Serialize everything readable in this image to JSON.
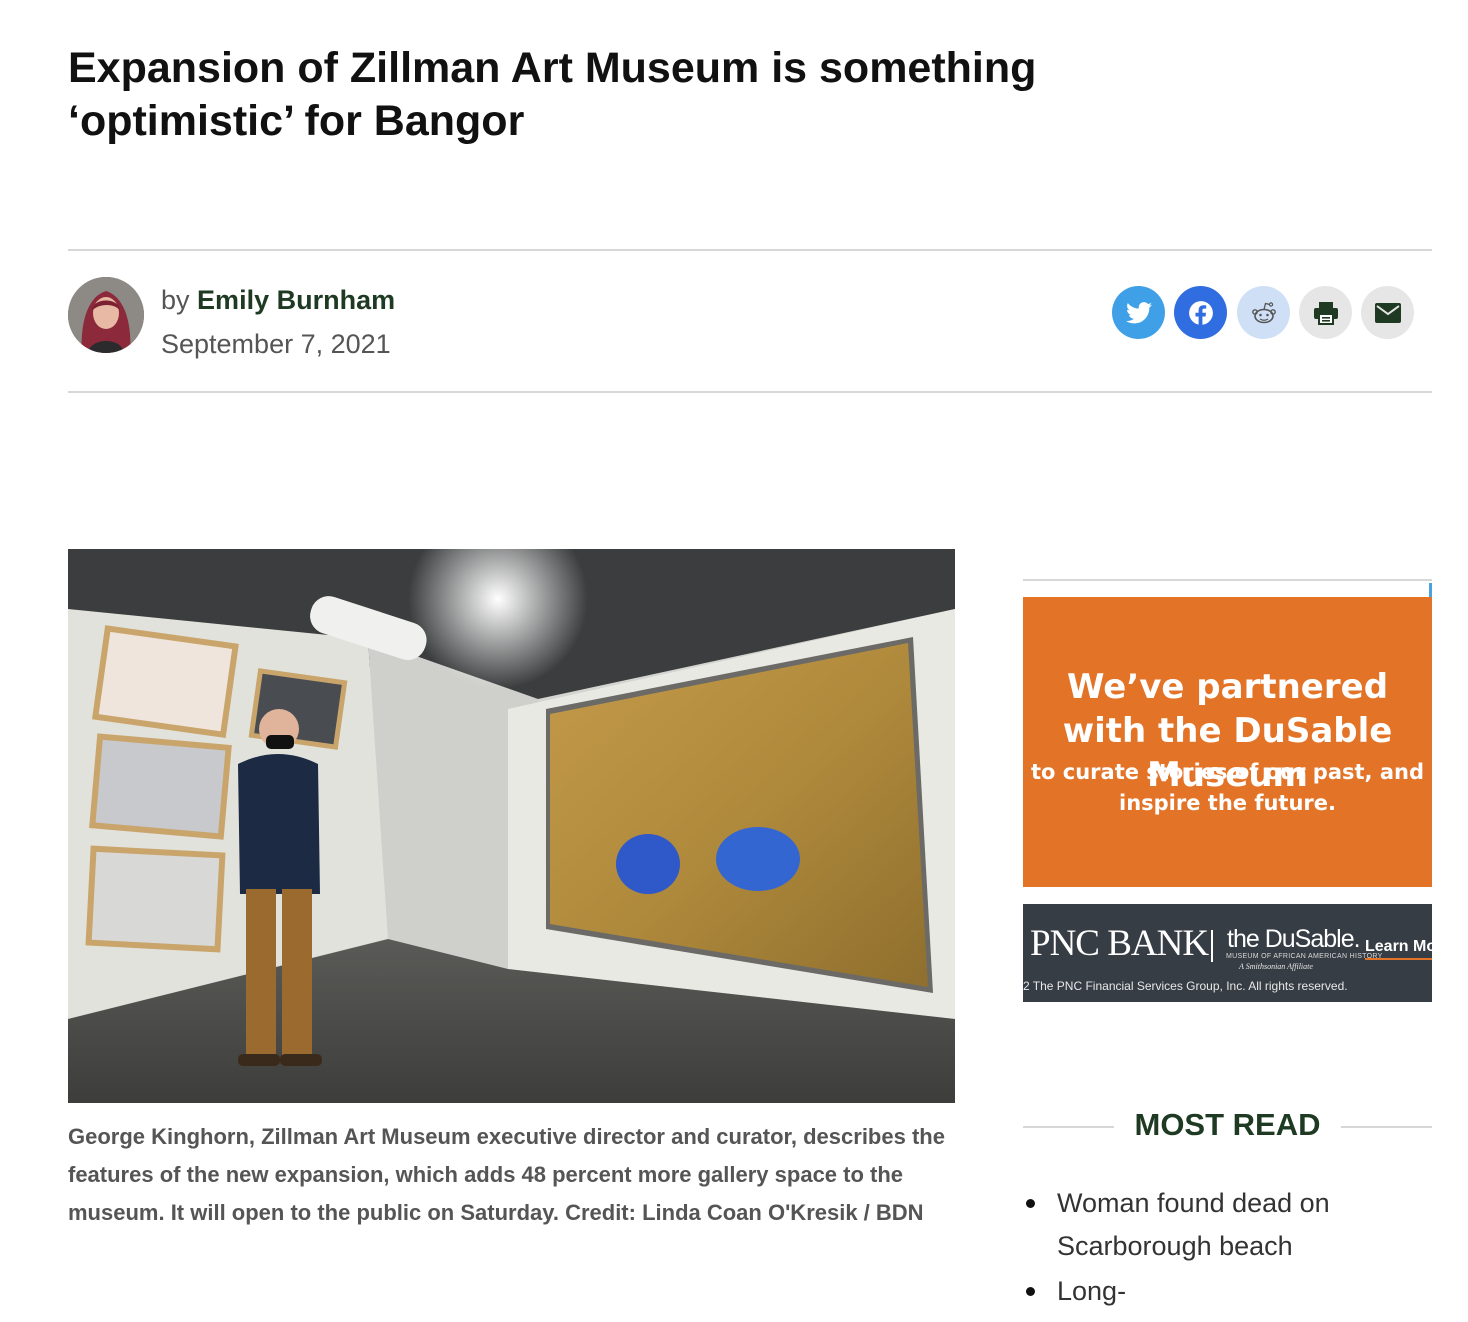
{
  "article": {
    "headline": "Expansion of Zillman Art Museum is something ‘optimistic’ for Bangor",
    "byline_prefix": "by",
    "author": "Emily Burnham",
    "date": "September 7, 2021",
    "share_icons": [
      "twitter-icon",
      "facebook-icon",
      "reddit-icon",
      "print-icon",
      "email-icon"
    ],
    "photo_caption": "George Kinghorn, Zillman Art Museum executive director and curator, describes the features of the new expansion, which adds 48 percent more gallery space to the museum. It will open to the public on Saturday. Credit: Linda Coan O'Kresik / BDN"
  },
  "ad": {
    "headline": "We’ve partnered with the DuSable Museum",
    "subline": "to curate stories of our past, and inspire the future.",
    "pnc_logo": "PNC BANK",
    "dusable_logo": "the DuSable.",
    "dusable_tagline": "MUSEUM OF AFRICAN AMERICAN HISTORY",
    "dusable_affiliate": "A Smithsonian Affiliate",
    "cta": "Learn Mo",
    "copyright": "2 The PNC Financial Services Group, Inc. All rights reserved.",
    "colors": {
      "orange": "#e37327",
      "dark": "#363d44"
    }
  },
  "most_read": {
    "title": "MOST READ",
    "items": [
      {
        "line1": "Woman found dead on",
        "line2": "Scarborough beach"
      },
      {
        "line1": "Long-hidde"
      }
    ]
  },
  "colors": {
    "accent_green": "#1e3a22",
    "twitter": "#3fa0e8",
    "facebook": "#2f6de1"
  }
}
